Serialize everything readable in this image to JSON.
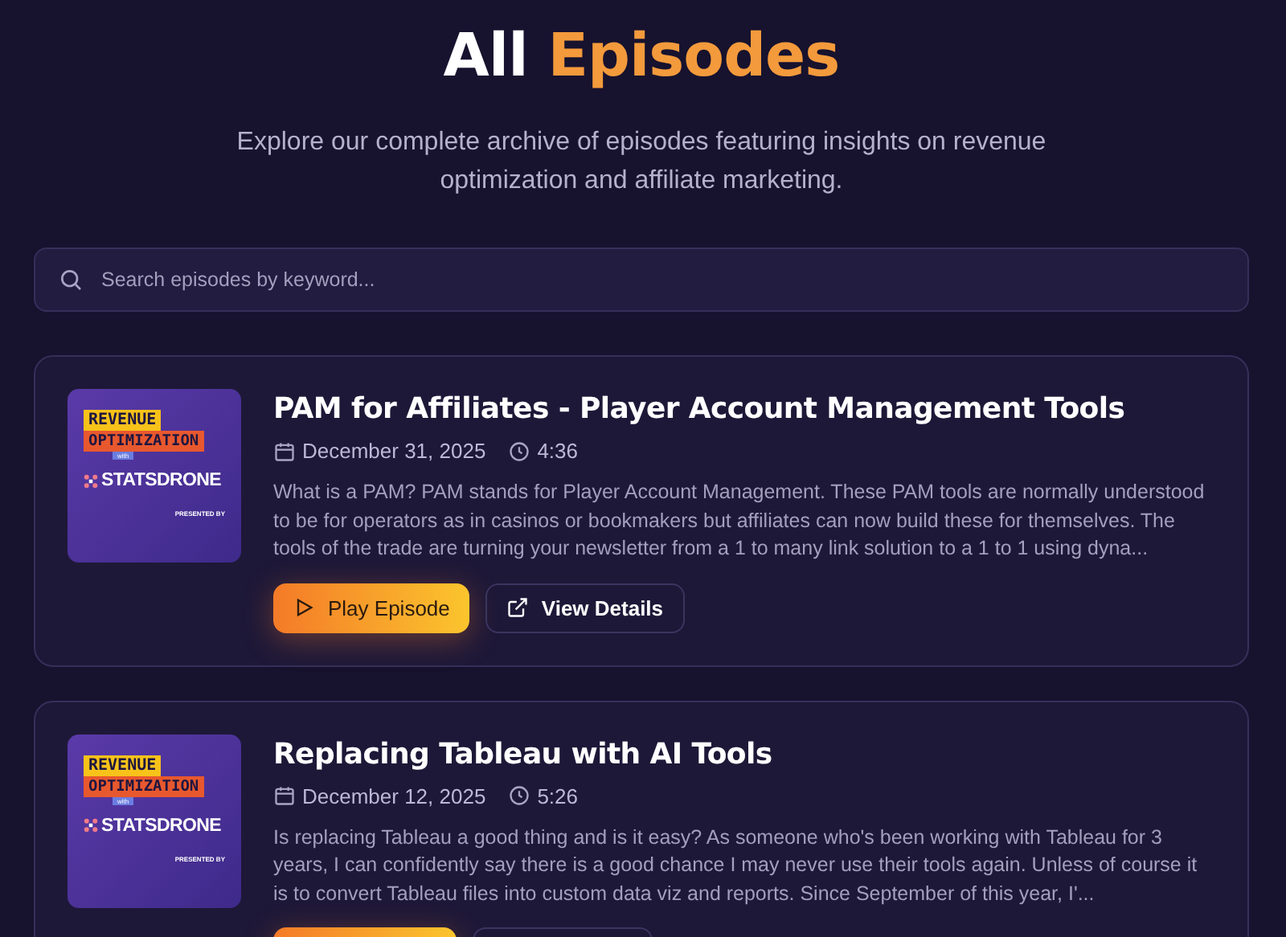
{
  "header": {
    "title": "All",
    "title_highlight": "Episodes",
    "subtitle": "Explore our complete archive of episodes featuring insights on revenue optimization and affiliate marketing."
  },
  "search": {
    "placeholder": "Search episodes by keyword..."
  },
  "episodes": [
    {
      "cover": {
        "line_1": "REVENUE",
        "line_2": "OPTIMIZATION",
        "with": "with",
        "brand": "STATSDRONE",
        "credit": "PRESENTED BY"
      },
      "title": "PAM for Affiliates - Player Account Management Tools",
      "date": "December 31, 2025",
      "duration": "4:36",
      "description": "What is a PAM? PAM stands for Player Account Management. These PAM tools are normally understood to be for operators as in casinos or bookmakers but affiliates can now build these for themselves. The tools of the trade are turning your newsletter from a 1 to many link solution to a 1 to 1 using dyna...",
      "play_label": "Play Episode",
      "details_label": "View Details"
    },
    {
      "cover": {
        "line_1": "REVENUE",
        "line_2": "OPTIMIZATION",
        "with": "with",
        "brand": "STATSDRONE",
        "credit": "PRESENTED BY"
      },
      "title": "Replacing Tableau with AI Tools",
      "date": "December 12, 2025",
      "duration": "5:26",
      "description": "Is replacing Tableau a good thing and is it easy? As someone who's been working with Tableau for 3 years, I can confidently say there is a good chance I may never use their tools again. Unless of course it is to convert Tableau files into custom data viz and reports. Since September of this year, I'..."
    }
  ]
}
